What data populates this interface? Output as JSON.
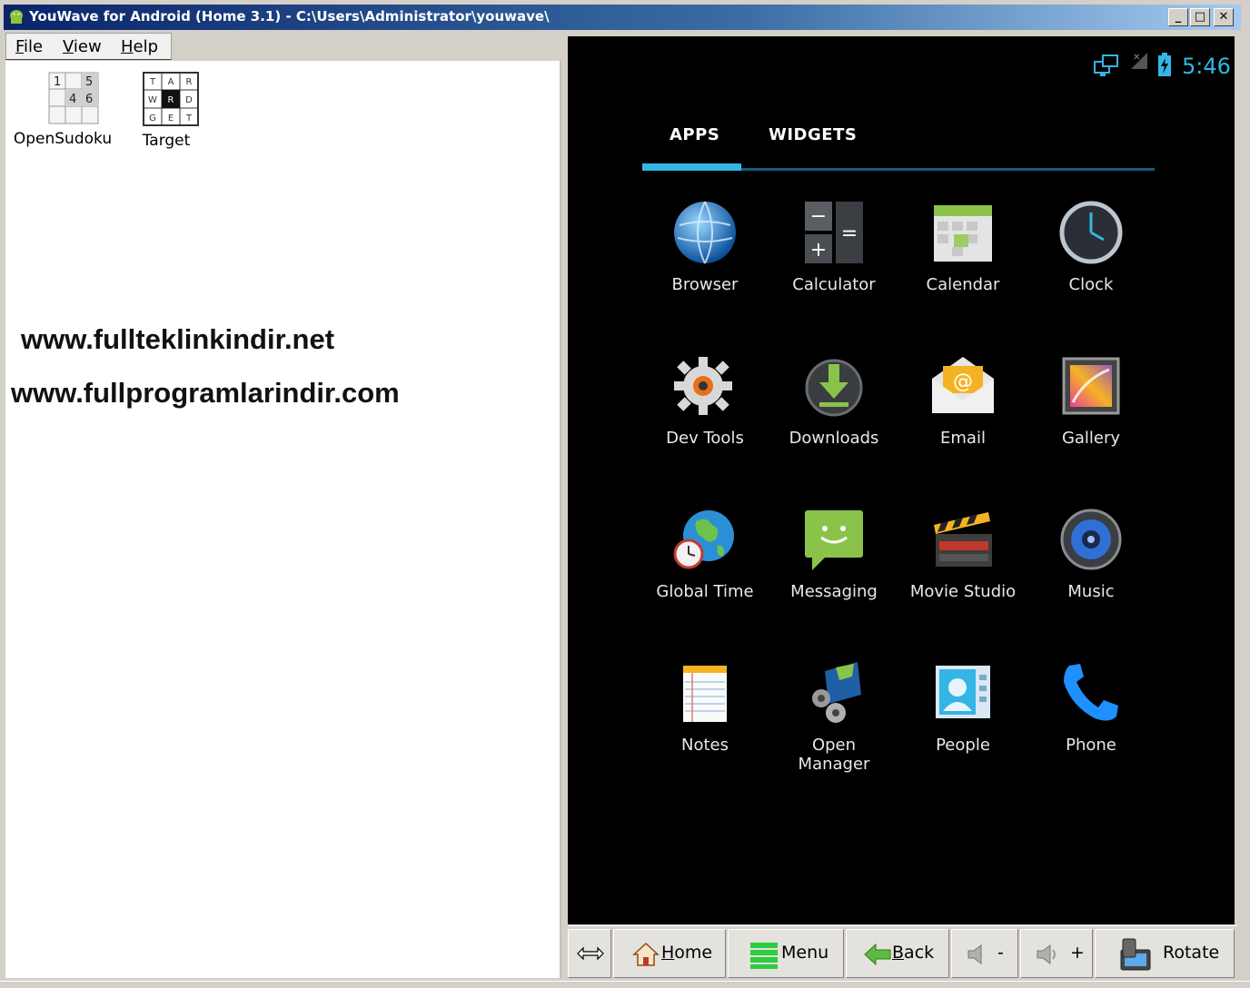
{
  "window": {
    "title": "YouWave for Android (Home 3.1) - C:\\Users\\Administrator\\youwave\\",
    "minimize_label": "_",
    "maximize_label": "□",
    "close_label": "✕"
  },
  "menu": {
    "file": {
      "accel": "F",
      "rest": "ile"
    },
    "view": {
      "accel": "V",
      "rest": "iew"
    },
    "help": {
      "accel": "H",
      "rest": "elp"
    }
  },
  "installed_apps": [
    {
      "label": "OpenSudoku"
    },
    {
      "label": "Target"
    }
  ],
  "sudoku_icon_digits": [
    "1",
    "5",
    "4",
    "6"
  ],
  "target_icon_letters": [
    "T",
    "A",
    "R",
    "W",
    "R",
    "D",
    "G",
    "E",
    "T"
  ],
  "watermarks": [
    "www.fullteklinkindir.net",
    "www.fullprogramlarindir.com"
  ],
  "android": {
    "status_time": "5:46",
    "tabs": [
      "APPS",
      "WIDGETS"
    ],
    "active_tab": "APPS",
    "accent_color": "#33b5e5",
    "apps": [
      {
        "name": "Browser",
        "icon": "globe-icon"
      },
      {
        "name": "Calculator",
        "icon": "calculator-icon"
      },
      {
        "name": "Calendar",
        "icon": "calendar-icon"
      },
      {
        "name": "Clock",
        "icon": "clock-icon"
      },
      {
        "name": "Dev Tools",
        "icon": "gear-icon"
      },
      {
        "name": "Downloads",
        "icon": "download-icon"
      },
      {
        "name": "Email",
        "icon": "email-icon"
      },
      {
        "name": "Gallery",
        "icon": "gallery-icon"
      },
      {
        "name": "Global Time",
        "icon": "world-clock-icon"
      },
      {
        "name": "Messaging",
        "icon": "message-icon"
      },
      {
        "name": "Movie Studio",
        "icon": "clapperboard-icon"
      },
      {
        "name": "Music",
        "icon": "speaker-icon"
      },
      {
        "name": "Notes",
        "icon": "notepad-icon"
      },
      {
        "name": "Open\nManager",
        "icon": "file-manager-icon"
      },
      {
        "name": "People",
        "icon": "contact-card-icon"
      },
      {
        "name": "Phone",
        "icon": "phone-icon"
      }
    ]
  },
  "toolbar": {
    "home": {
      "accel": "H",
      "rest": "ome"
    },
    "menu": "Menu",
    "back": {
      "accel": "B",
      "rest": "ack"
    },
    "vol_down": "-",
    "vol_up": "+",
    "rotate": "Rotate"
  }
}
